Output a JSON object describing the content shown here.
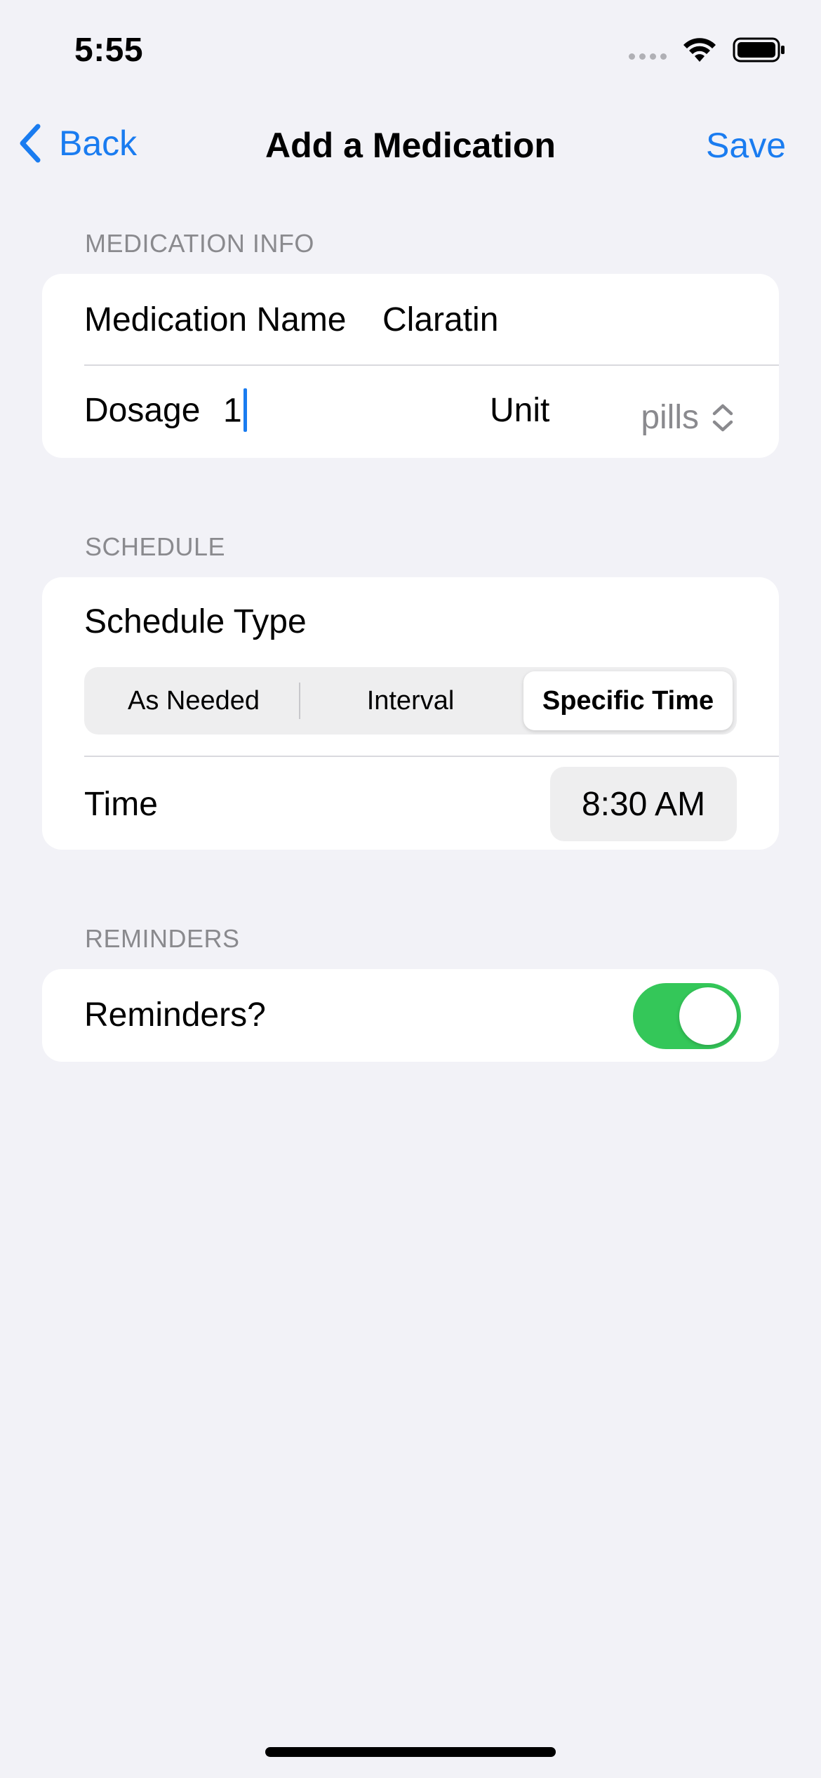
{
  "status_bar": {
    "time": "5:55"
  },
  "nav": {
    "back_label": "Back",
    "title": "Add a Medication",
    "save_label": "Save"
  },
  "sections": {
    "medication_info": "MEDICATION INFO",
    "schedule": "SCHEDULE",
    "reminders": "REMINDERS"
  },
  "medication": {
    "name_label": "Medication Name",
    "name_value": "Claratin",
    "dosage_label": "Dosage",
    "dosage_value": "1",
    "unit_label": "Unit",
    "unit_value": "pills"
  },
  "schedule": {
    "type_label": "Schedule Type",
    "options": [
      "As Needed",
      "Interval",
      "Specific Time"
    ],
    "selected": "Specific Time",
    "time_label": "Time",
    "time_value": "8:30 AM"
  },
  "reminders": {
    "label": "Reminders?",
    "enabled": true
  },
  "colors": {
    "accent": "#1A7CF0",
    "toggle_on": "#34C759",
    "background": "#F2F2F7",
    "secondary_text": "#8A8A8E"
  },
  "icons": [
    "chevron-left-icon",
    "chevron-up-down-icon",
    "wifi-icon",
    "battery-icon",
    "cellular-signal-icon"
  ]
}
